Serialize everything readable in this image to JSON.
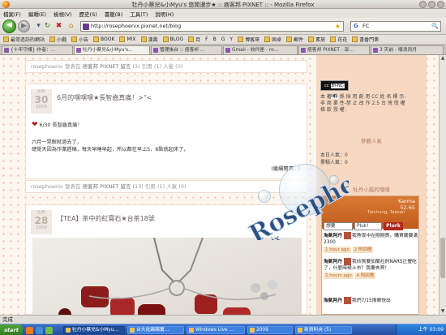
{
  "window": {
    "title": "牡丹小蔡兒&小Myu's 悠閒漫步★ :: 痞客邦 PIXNET :: - Mozilla Firefox"
  },
  "menu": [
    "檔案(F)",
    "編輯(E)",
    "檢視(V)",
    "歷史(S)",
    "書籤(B)",
    "工具(T)",
    "說明(H)"
  ],
  "nav": {
    "url": "http://rosephoenix.pixnet.net/blog",
    "search_value": "FC",
    "search_engine": "G"
  },
  "bookmarks": [
    "最常造訪的網站",
    "小戲",
    "小告",
    "BOOK",
    "MIX",
    "漢壽",
    "BLOG",
    "月",
    "F",
    "B",
    "G",
    "Y",
    "博客來",
    "固卓",
    "郵件",
    "素放",
    "花花",
    "書香門第"
  ],
  "tabs": [
    {
      "label": "{十年守護} 作者：...",
      "active": false
    },
    {
      "label": "牡丹小蔡兒&小Myu's...",
      "active": true
    },
    {
      "label": "管理後台 :: 痞客邦 ...",
      "active": false
    },
    {
      "label": "Gmail - 收件匣 - ro...",
      "active": false
    },
    {
      "label": "痞客邦 PIXNET - 部...",
      "active": false
    },
    {
      "label": "3 天前 - 噗浪同月",
      "active": false
    }
  ],
  "posts": {
    "footer1": {
      "author": "rosephoenix 發表在",
      "site": "痞客邦 PIXNET 留言",
      "stats": "(3) 引用 (1) 人氣 (0)"
    },
    "post1": {
      "month": "JUN",
      "day": "30",
      "year": "2009",
      "title": "6月的嘿嘿嘿★長智齒真痛！>\"<",
      "line1": "6/30 長智齒真痛！",
      "line2": "六月一晃眼就過去了，",
      "line3": "總覺天因為作業趕稿，每天早睡早起，所以都在早上5、6點就起床了，",
      "more": "(繼續閱讀...)"
    },
    "footer2": {
      "author": "rosephoenix 發表在",
      "site": "痞客邦 PIXNET 留言",
      "stats": "(13) 引用 (1) 人氣 (0)"
    },
    "post2": {
      "month": "JUN",
      "day": "28",
      "year": "2009",
      "title": "【TEA】茶中的紅寶石★台茶18號"
    }
  },
  "sidebar": {
    "cc_label": "cc",
    "cc_sub": "BY-NC-ND",
    "license_lines": [
      "本 著 作 係 採 用 創 用 CC 姓 名 標 示-",
      "非 商 業 性-禁 止 改 作 2.5 台 灣 授 權",
      "條 款 授 權 ."
    ],
    "visitors_title": "參觀人氣",
    "today": "本日人氣：0",
    "total": "累積人氣：0",
    "plurk_title": "牡丹小鳳的噗噗",
    "karma": "Karma",
    "karma_value": "52.65",
    "location": "Taichung, Taiwan",
    "plurk_select": "想要",
    "plurk_field": "Pluk!",
    "plurk_button": "Plurk",
    "items": [
      {
        "name": "淘氣阿丹",
        "text": "我熬夜中在剛剛買，購買蘭要滿2300",
        "time": "1 hour ago",
        "reply": "2 則回應"
      },
      {
        "name": "淘氣阿丹",
        "text": "我欣賞要加蘭拉的NARS正豐吃了，什麼時候上市？我要去買！",
        "time": "1 hours ago",
        "reply": "4 則回應"
      },
      {
        "name": "淘氣阿丹",
        "text": "我們7/15揹樂快出",
        "time": "",
        "reply": ""
      }
    ]
  },
  "logo_text": "Rosephe",
  "logo_small": "nix",
  "status": "完成",
  "taskbar": {
    "start": "start",
    "tasks": [
      {
        "label": "牡丹小蔡兒&小Myu...",
        "active": true
      },
      {
        "label": "台大批踢踢實...",
        "active": false
      },
      {
        "label": "Windows Live ...",
        "active": false
      },
      {
        "label": "2009",
        "active": false
      },
      {
        "label": "新資料夾 (5)",
        "active": false
      }
    ],
    "clock": "上午 03:09"
  },
  "colors": {
    "accent": "#c05b1d",
    "plurk_red": "#b3261e",
    "bg_peach": "#f7d9c2"
  }
}
